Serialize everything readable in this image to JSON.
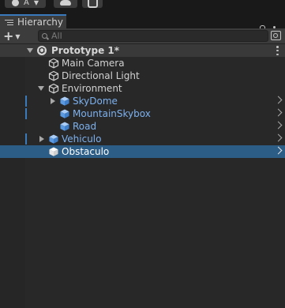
{
  "toolbar": {
    "account_label": "A",
    "account_icon": "account-icon",
    "cloud_icon": "cloud-icon",
    "collab_icon": "collab-icon"
  },
  "tab": {
    "label": "Hierarchy",
    "icon": "hierarchy-list-icon"
  },
  "search": {
    "placeholder": "All",
    "value": ""
  },
  "colors": {
    "accent": "#3a79bb",
    "selected_row": "#2c5d87",
    "prefab_text": "#7cb1ef",
    "panel_bg": "#282828"
  },
  "tree": {
    "scene": {
      "label": "Prototype 1*",
      "expanded": true
    },
    "items": [
      {
        "label": "Main Camera",
        "kind": "gameobject",
        "depth": 1
      },
      {
        "label": "Directional Light",
        "kind": "gameobject",
        "depth": 1
      },
      {
        "label": "Environment",
        "kind": "gameobject",
        "depth": 1,
        "expanded": true
      },
      {
        "label": "SkyDome",
        "kind": "prefab",
        "depth": 2,
        "expanded": false
      },
      {
        "label": "MountainSkybox",
        "kind": "prefab",
        "depth": 2
      },
      {
        "label": "Road",
        "kind": "prefab",
        "depth": 2
      },
      {
        "label": "Vehiculo",
        "kind": "prefab",
        "depth": 1,
        "expanded": false
      },
      {
        "label": "Obstaculo",
        "kind": "prefab",
        "depth": 1,
        "selected": true
      }
    ]
  }
}
